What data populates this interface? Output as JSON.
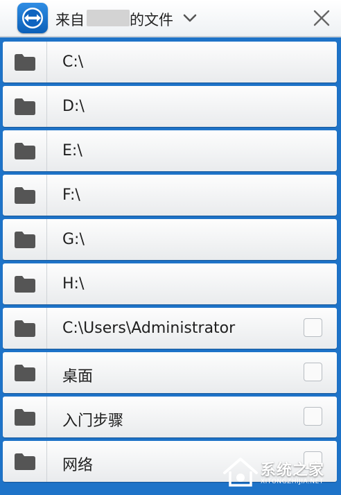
{
  "header": {
    "title_prefix": "来自",
    "title_suffix": "的文件"
  },
  "icons": {
    "logo": "teamviewer-logo",
    "dropdown": "chevron-down-icon",
    "close": "close-icon",
    "folder": "folder-icon"
  },
  "rows": [
    {
      "label": "C:\\",
      "checkbox": false
    },
    {
      "label": "D:\\",
      "checkbox": false
    },
    {
      "label": "E:\\",
      "checkbox": false
    },
    {
      "label": "F:\\",
      "checkbox": false
    },
    {
      "label": "G:\\",
      "checkbox": false
    },
    {
      "label": "H:\\",
      "checkbox": false
    },
    {
      "label": "C:\\Users\\Administrator",
      "checkbox": true,
      "checked": false
    },
    {
      "label": "桌面",
      "checkbox": true,
      "checked": false
    },
    {
      "label": "入门步骤",
      "checkbox": true,
      "checked": false
    },
    {
      "label": "网络",
      "checkbox": true,
      "checked": false
    }
  ],
  "watermark": {
    "text": "系统之家",
    "url": "XITONGZHIJIA.NET"
  },
  "colors": {
    "background_blue": "#1e73c8",
    "folder_gray": "#555555"
  }
}
